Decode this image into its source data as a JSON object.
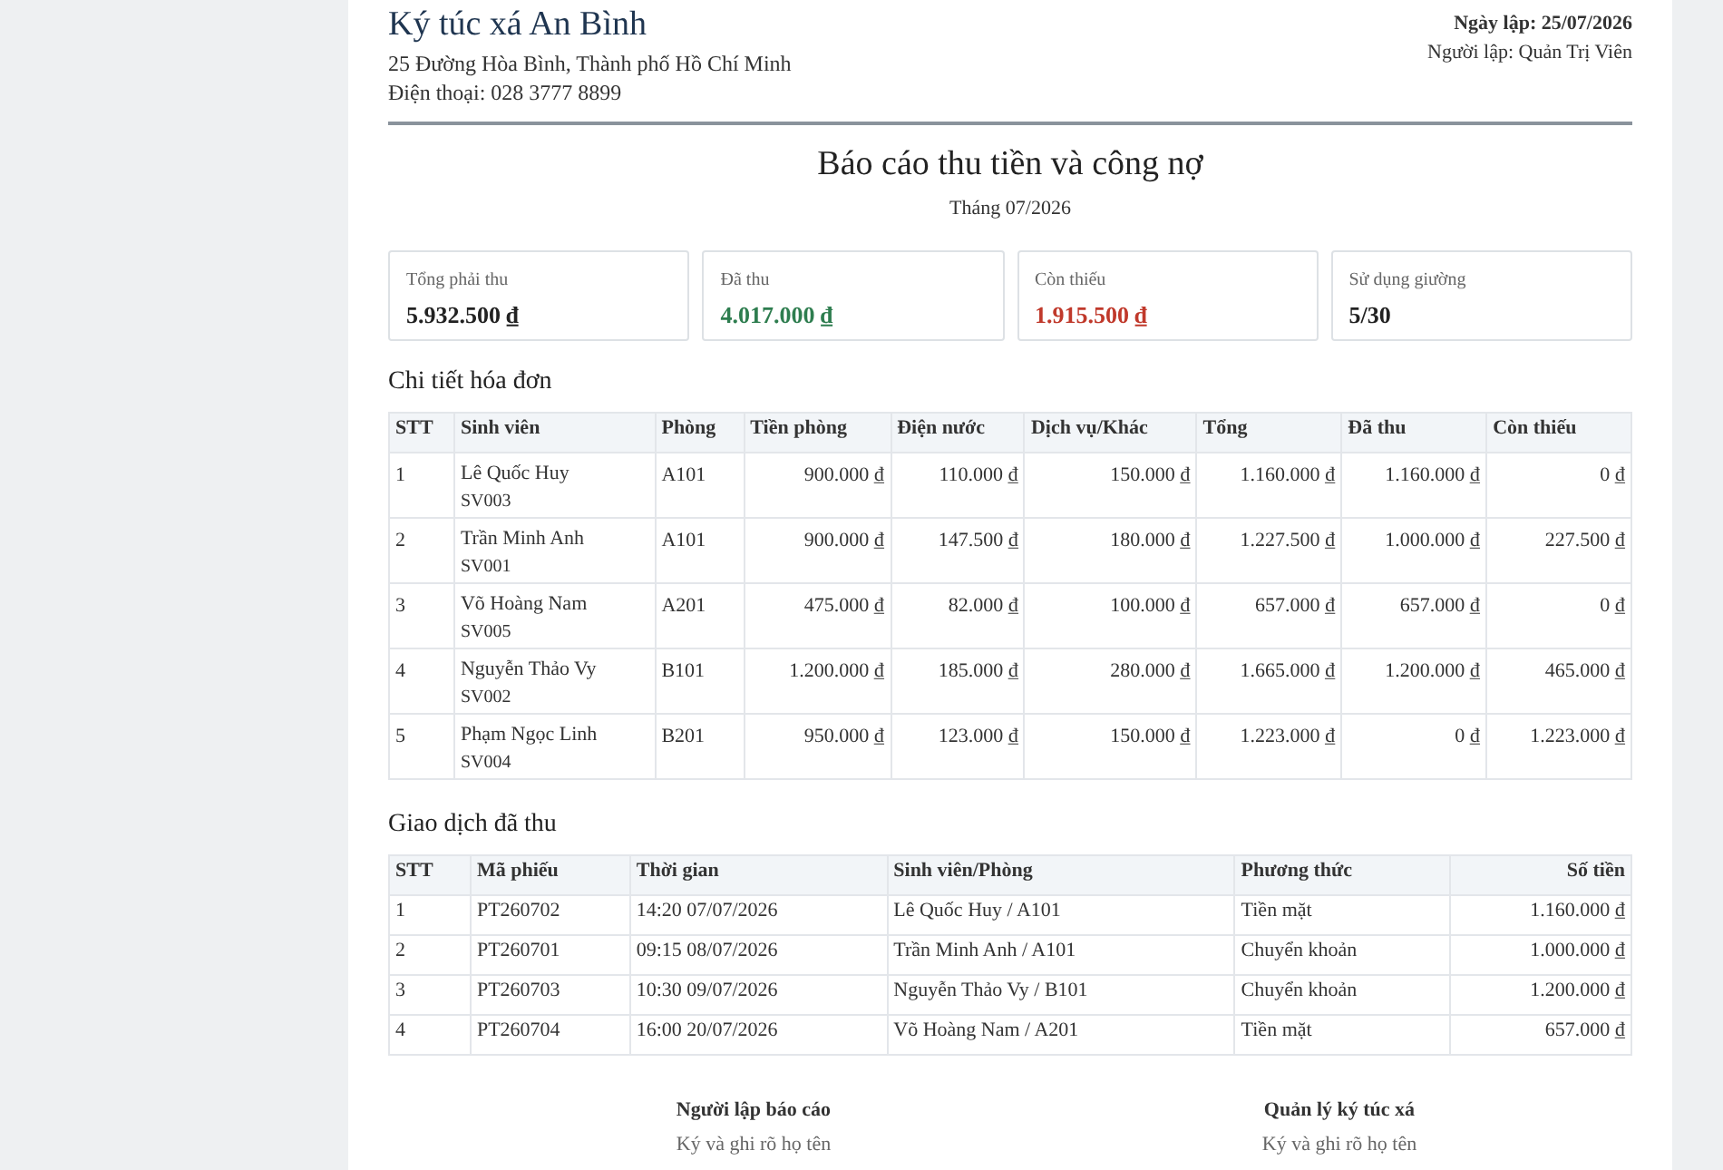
{
  "org": {
    "name": "Ký túc xá An Bình",
    "address": "25 Đường Hòa Bình, Thành phố Hồ Chí Minh",
    "phone": "Điện thoại: 028 3777 8899"
  },
  "meta": {
    "created": "Ngày lập: 25/07/2026",
    "author": "Người lập: Quản Trị Viên"
  },
  "report": {
    "title": "Báo cáo thu tiền và công nợ",
    "period": "Tháng 07/2026"
  },
  "summary": [
    {
      "label": "Tổng phải thu",
      "value": "5.932.500 ₫",
      "kind": "neutral"
    },
    {
      "label": "Đã thu",
      "value": "4.017.000 ₫",
      "kind": "positive"
    },
    {
      "label": "Còn thiếu",
      "value": "1.915.500 ₫",
      "kind": "negative"
    },
    {
      "label": "Sử dụng giường",
      "value": "5/30",
      "kind": "neutral"
    }
  ],
  "invoices": {
    "heading": "Chi tiết hóa đơn",
    "columns": [
      "STT",
      "Sinh viên",
      "Phòng",
      "Tiền phòng",
      "Điện nước",
      "Dịch vụ/Khác",
      "Tổng",
      "Đã thu",
      "Còn thiếu"
    ],
    "rows": [
      {
        "no": "1",
        "name": "Lê Quốc Huy",
        "code": "SV003",
        "room": "A101",
        "amounts": [
          "900.000 ₫",
          "110.000 ₫",
          "150.000 ₫",
          "1.160.000 ₫",
          "1.160.000 ₫",
          "0 ₫"
        ]
      },
      {
        "no": "2",
        "name": "Trần Minh Anh",
        "code": "SV001",
        "room": "A101",
        "amounts": [
          "900.000 ₫",
          "147.500 ₫",
          "180.000 ₫",
          "1.227.500 ₫",
          "1.000.000 ₫",
          "227.500 ₫"
        ]
      },
      {
        "no": "3",
        "name": "Võ Hoàng Nam",
        "code": "SV005",
        "room": "A201",
        "amounts": [
          "475.000 ₫",
          "82.000 ₫",
          "100.000 ₫",
          "657.000 ₫",
          "657.000 ₫",
          "0 ₫"
        ]
      },
      {
        "no": "4",
        "name": "Nguyễn Thảo Vy",
        "code": "SV002",
        "room": "B101",
        "amounts": [
          "1.200.000 ₫",
          "185.000 ₫",
          "280.000 ₫",
          "1.665.000 ₫",
          "1.200.000 ₫",
          "465.000 ₫"
        ]
      },
      {
        "no": "5",
        "name": "Phạm Ngọc Linh",
        "code": "SV004",
        "room": "B201",
        "amounts": [
          "950.000 ₫",
          "123.000 ₫",
          "150.000 ₫",
          "1.223.000 ₫",
          "0 ₫",
          "1.223.000 ₫"
        ]
      }
    ]
  },
  "payments": {
    "heading": "Giao dịch đã thu",
    "columns": [
      "STT",
      "Mã phiếu",
      "Thời gian",
      "Sinh viên/Phòng",
      "Phương thức",
      "Số tiền"
    ],
    "rows": [
      [
        "1",
        "PT260702",
        "14:20 07/07/2026",
        "Lê Quốc Huy / A101",
        "Tiền mặt",
        "1.160.000 ₫"
      ],
      [
        "2",
        "PT260701",
        "09:15 08/07/2026",
        "Trần Minh Anh / A101",
        "Chuyển khoản",
        "1.000.000 ₫"
      ],
      [
        "3",
        "PT260703",
        "10:30 09/07/2026",
        "Nguyễn Thảo Vy / B101",
        "Chuyển khoản",
        "1.200.000 ₫"
      ],
      [
        "4",
        "PT260704",
        "16:00 20/07/2026",
        "Võ Hoàng Nam / A201",
        "Tiền mặt",
        "657.000 ₫"
      ]
    ]
  },
  "signatures": [
    {
      "role": "Người lập báo cáo",
      "hint": "Ký và ghi rõ họ tên"
    },
    {
      "role": "Quản lý ký túc xá",
      "hint": "Ký và ghi rõ họ tên"
    }
  ]
}
